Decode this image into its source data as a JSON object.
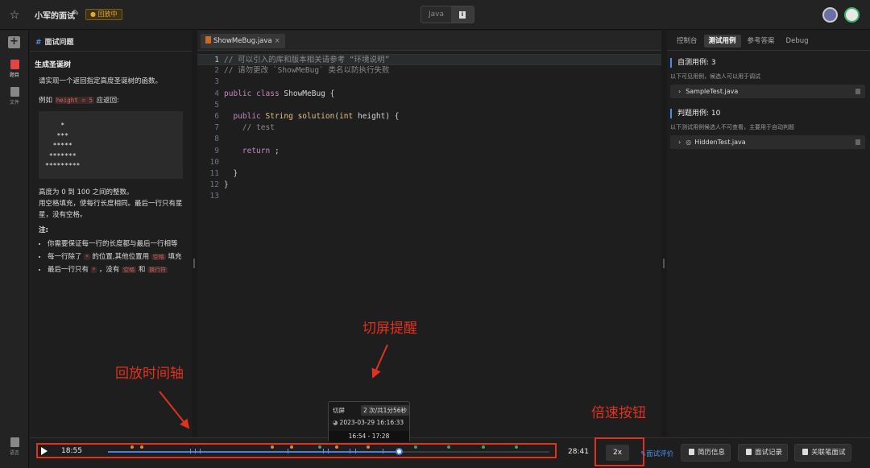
{
  "header": {
    "title": "小军的面试",
    "status_badge": "● 回放中",
    "language": "Java",
    "language_info_icon": "info-icon"
  },
  "rail": {
    "items": [
      {
        "label": "题目",
        "icon": "question-icon"
      },
      {
        "label": "文件",
        "icon": "folder-icon"
      },
      {
        "label": "语言",
        "icon": "language-icon"
      }
    ]
  },
  "question": {
    "header": "面试问题",
    "title": "生成圣诞树",
    "intro": "请实现一个返回指定高度圣诞树的函数。",
    "example_prefix": "例如",
    "example_code": "height = 5",
    "example_suffix": "应返回:",
    "tree": "    *\n   ***\n  *****\n *******\n*********",
    "range_note": "高度为 0 到 100 之间的整数。",
    "fill_note": "用空格填充，使每行长度相同。最后一行只有星星，没有空格。",
    "notes_title": "注:",
    "bullets": {
      "b1": "你需要保证每一行的长度都与最后一行相等",
      "b2_prefix": "每一行除了",
      "b2_tag1": "*",
      "b2_mid": "的位置,其他位置用",
      "b2_tag2": "空格",
      "b2_suffix": "填充",
      "b3_prefix": "最后一行只有",
      "b3_tag1": "*",
      "b3_mid1": "，没有",
      "b3_tag2": "空格",
      "b3_mid2": "和",
      "b3_tag3": "换行符"
    }
  },
  "editor": {
    "tab_name": "ShowMeBug.java",
    "tab_close": "×",
    "lines": [
      {
        "n": "1",
        "text": "// 可以引入的库和版本相关请参考 “环境说明”"
      },
      {
        "n": "2",
        "text": "// 请勿更改 `ShowMeBug` 类名以防执行失败"
      },
      {
        "n": "3",
        "text": ""
      },
      {
        "n": "4",
        "text": "public class ShowMeBug {"
      },
      {
        "n": "5",
        "text": ""
      },
      {
        "n": "6",
        "text": "  public String solution(int height) {"
      },
      {
        "n": "7",
        "text": "    // test"
      },
      {
        "n": "8",
        "text": ""
      },
      {
        "n": "9",
        "text": "    return ;"
      },
      {
        "n": "10",
        "text": ""
      },
      {
        "n": "11",
        "text": "  }"
      },
      {
        "n": "12",
        "text": "}"
      },
      {
        "n": "13",
        "text": ""
      }
    ]
  },
  "right_panel": {
    "tabs": [
      "控制台",
      "测试用例",
      "参考答案",
      "Debug"
    ],
    "active_tab": "测试用例",
    "self_test_title": "自测用例:  3",
    "self_test_desc": "以下可见用例，候选人可以用于调试",
    "self_test_file": "SampleTest.java",
    "judge_title": "判题用例:  10",
    "judge_desc": "以下测试用例候选人不可查看，主要用于自动判题",
    "judge_file": "HiddenTest.java"
  },
  "annotations": {
    "switch_hint": "切屏提醒",
    "timeline": "回放时间轴",
    "speed": "倍速按钮"
  },
  "tooltip": {
    "label": "切屏",
    "count": "2 次/共1分56秒",
    "datetime": "2023-03-29 16:16:33",
    "range": "16:54 - 17:28"
  },
  "player": {
    "current_time": "18:55",
    "total_time": "28:41",
    "progress": 0.66,
    "speed": "2x",
    "eval_link": "面试评价",
    "buttons": [
      "简历信息",
      "面试记录",
      "关联笔面试"
    ]
  },
  "colors": {
    "accent": "#4d8ce8",
    "annotation": "#e0321e",
    "badge": "#e7a530"
  }
}
